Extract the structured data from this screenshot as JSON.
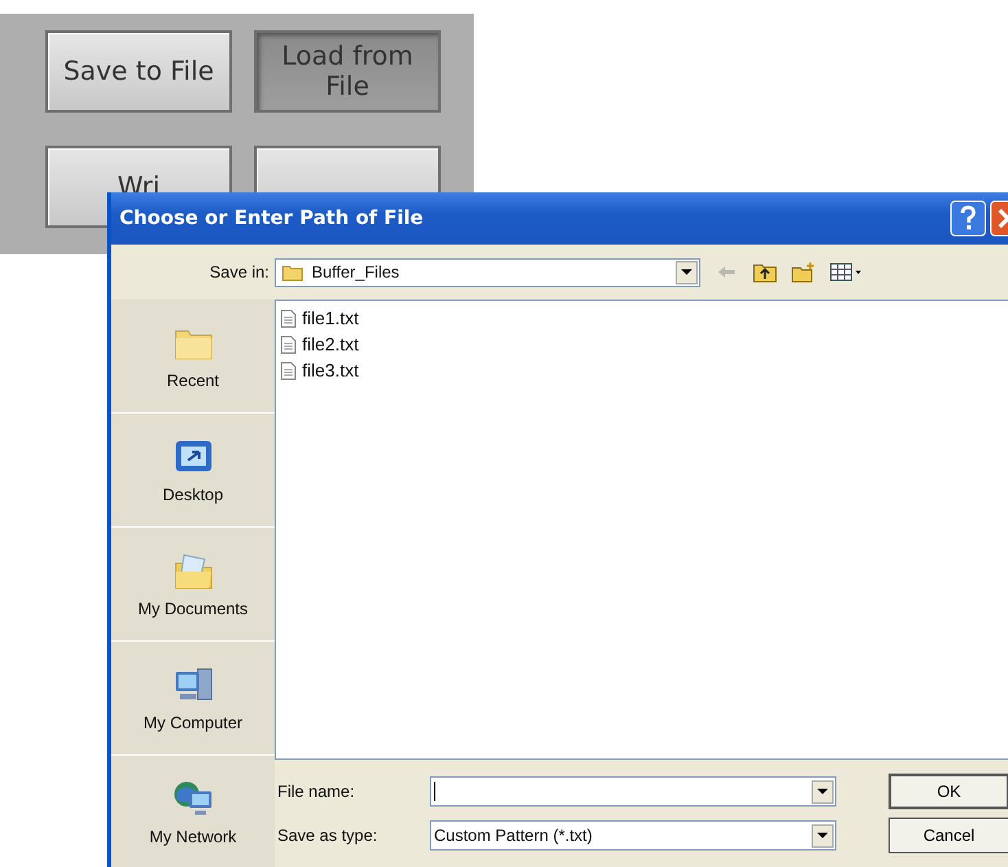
{
  "panel": {
    "buttons": [
      {
        "label": "Save to File",
        "pressed": false
      },
      {
        "label": "Load from File",
        "pressed": true
      },
      {
        "label": "Wri",
        "pressed": false
      },
      {
        "pressed": false
      }
    ]
  },
  "dialog": {
    "title": "Choose or Enter Path of File",
    "save_in": {
      "label": "Save in:",
      "value": "Buffer_Files"
    },
    "places": [
      {
        "label": "Recent",
        "kind": "recent"
      },
      {
        "label": "Desktop",
        "kind": "desktop"
      },
      {
        "label": "My Documents",
        "kind": "documents"
      },
      {
        "label": "My Computer",
        "kind": "computer"
      },
      {
        "label": "My Network",
        "kind": "network"
      }
    ],
    "files": [
      "file1.txt",
      "file2.txt",
      "file3.txt"
    ],
    "file_name": {
      "label": "File name:"
    },
    "save_as_type": {
      "label": "Save as type:",
      "value": "Custom Pattern (*.txt)"
    },
    "buttons": [
      "OK",
      "Cancel"
    ]
  }
}
